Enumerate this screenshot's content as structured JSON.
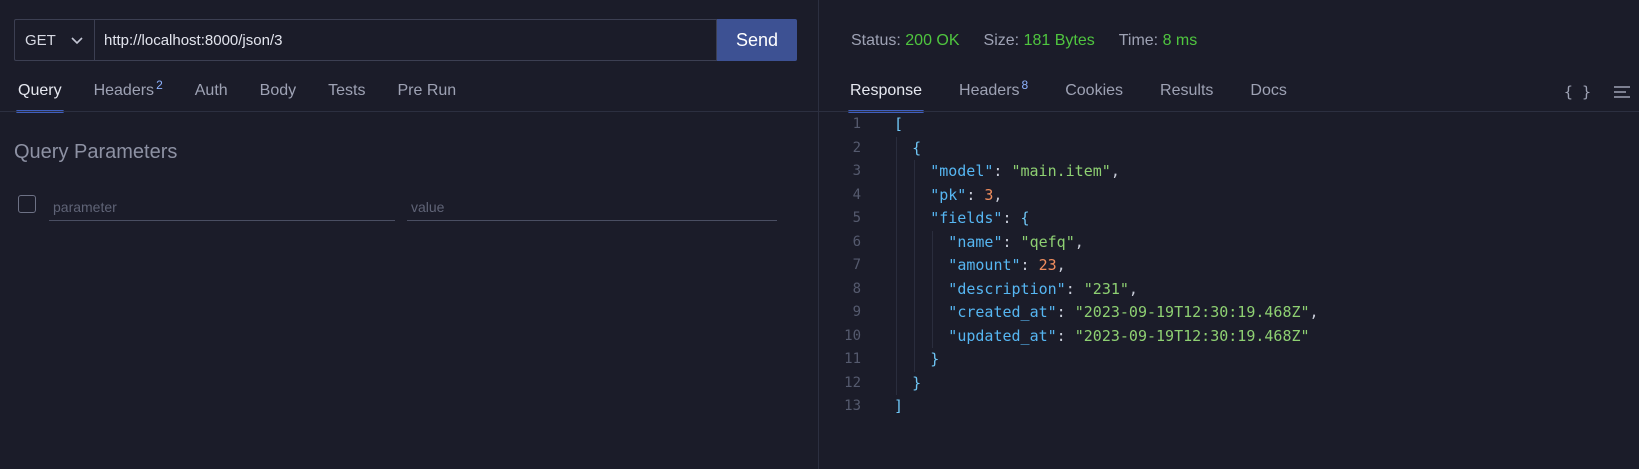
{
  "request": {
    "method": "GET",
    "url": "http://localhost:8000/json/3",
    "send_label": "Send",
    "tabs": [
      {
        "label": "Query",
        "badge": ""
      },
      {
        "label": "Headers",
        "badge": "2"
      },
      {
        "label": "Auth",
        "badge": ""
      },
      {
        "label": "Body",
        "badge": ""
      },
      {
        "label": "Tests",
        "badge": ""
      },
      {
        "label": "Pre Run",
        "badge": ""
      }
    ],
    "active_tab": "Query",
    "query_title": "Query Parameters",
    "param_placeholder": "parameter",
    "value_placeholder": "value"
  },
  "response": {
    "status_label": "Status:",
    "status_value": "200 OK",
    "size_label": "Size:",
    "size_value": "181 Bytes",
    "time_label": "Time:",
    "time_value": "8 ms",
    "tabs": [
      {
        "label": "Response",
        "badge": ""
      },
      {
        "label": "Headers",
        "badge": "8"
      },
      {
        "label": "Cookies",
        "badge": ""
      },
      {
        "label": "Results",
        "badge": ""
      },
      {
        "label": "Docs",
        "badge": ""
      }
    ],
    "active_tab": "Response",
    "format_icon": "{ }",
    "lines": [
      {
        "n": "1",
        "indent": 0,
        "tokens": [
          [
            "b",
            "["
          ]
        ]
      },
      {
        "n": "2",
        "indent": 1,
        "tokens": [
          [
            "b",
            "{"
          ]
        ]
      },
      {
        "n": "3",
        "indent": 2,
        "tokens": [
          [
            "k",
            "\"model\""
          ],
          [
            "p",
            ": "
          ],
          [
            "s",
            "\"main.item\""
          ],
          [
            "p",
            ","
          ]
        ]
      },
      {
        "n": "4",
        "indent": 2,
        "tokens": [
          [
            "k",
            "\"pk\""
          ],
          [
            "p",
            ": "
          ],
          [
            "n",
            "3"
          ],
          [
            "p",
            ","
          ]
        ]
      },
      {
        "n": "5",
        "indent": 2,
        "tokens": [
          [
            "k",
            "\"fields\""
          ],
          [
            "p",
            ": "
          ],
          [
            "b",
            "{"
          ]
        ]
      },
      {
        "n": "6",
        "indent": 3,
        "tokens": [
          [
            "k",
            "\"name\""
          ],
          [
            "p",
            ": "
          ],
          [
            "s",
            "\"qefq\""
          ],
          [
            "p",
            ","
          ]
        ]
      },
      {
        "n": "7",
        "indent": 3,
        "tokens": [
          [
            "k",
            "\"amount\""
          ],
          [
            "p",
            ": "
          ],
          [
            "n",
            "23"
          ],
          [
            "p",
            ","
          ]
        ]
      },
      {
        "n": "8",
        "indent": 3,
        "tokens": [
          [
            "k",
            "\"description\""
          ],
          [
            "p",
            ": "
          ],
          [
            "s",
            "\"231\""
          ],
          [
            "p",
            ","
          ]
        ]
      },
      {
        "n": "9",
        "indent": 3,
        "tokens": [
          [
            "k",
            "\"created_at\""
          ],
          [
            "p",
            ": "
          ],
          [
            "s",
            "\"2023-09-19T12:30:19.468Z\""
          ],
          [
            "p",
            ","
          ]
        ]
      },
      {
        "n": "10",
        "indent": 3,
        "tokens": [
          [
            "k",
            "\"updated_at\""
          ],
          [
            "p",
            ": "
          ],
          [
            "s",
            "\"2023-09-19T12:30:19.468Z\""
          ]
        ]
      },
      {
        "n": "11",
        "indent": 2,
        "tokens": [
          [
            "b",
            "}"
          ]
        ]
      },
      {
        "n": "12",
        "indent": 1,
        "tokens": [
          [
            "b",
            "}"
          ]
        ]
      },
      {
        "n": "13",
        "indent": 0,
        "tokens": [
          [
            "b",
            "]"
          ]
        ]
      }
    ]
  },
  "colors": {
    "background": "#1b1c29",
    "send_button": "#3d5193",
    "status_ok": "#4fc53f",
    "json_key": "#56b6f2",
    "json_string": "#8ed072",
    "json_number": "#f08d5d"
  },
  "icons": [
    "chevron-down-icon",
    "braces-icon",
    "menu-lines-icon"
  ]
}
